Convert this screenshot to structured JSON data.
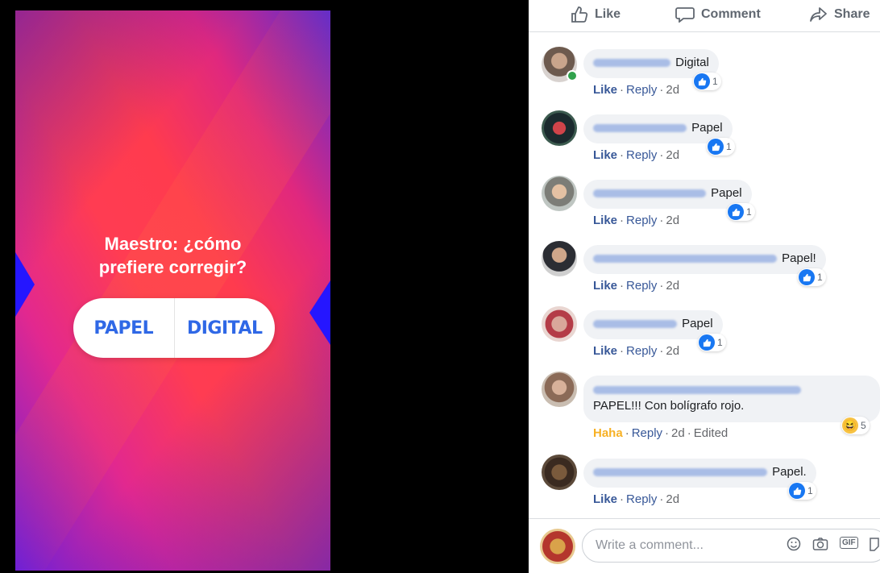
{
  "story": {
    "question_line1": "Maestro: ¿cómo",
    "question_line2": "prefiere corregir?",
    "option_a": "PAPEL",
    "option_b": "DIGITAL"
  },
  "actions": {
    "like": "Like",
    "comment": "Comment",
    "share": "Share"
  },
  "comments": [
    {
      "text": "Digital",
      "like_label": "Like",
      "reply": "Reply",
      "time": "2d",
      "reaction_count": "1"
    },
    {
      "text": "Papel",
      "like_label": "Like",
      "reply": "Reply",
      "time": "2d",
      "reaction_count": "1"
    },
    {
      "text": "Papel",
      "like_label": "Like",
      "reply": "Reply",
      "time": "2d",
      "reaction_count": "1"
    },
    {
      "text": "Papel!",
      "like_label": "Like",
      "reply": "Reply",
      "time": "2d",
      "reaction_count": "1"
    },
    {
      "text": "Papel",
      "like_label": "Like",
      "reply": "Reply",
      "time": "2d",
      "reaction_count": "1"
    },
    {
      "text": "PAPEL!!! Con bolígrafo rojo.",
      "like_label": "Haha",
      "reply": "Reply",
      "time": "2d",
      "edited": "Edited",
      "reaction_count": "5"
    },
    {
      "text": "Papel.",
      "like_label": "Like",
      "reply": "Reply",
      "time": "2d",
      "reaction_count": "1"
    }
  ],
  "compose": {
    "placeholder": "Write a comment...",
    "gif": "GIF"
  },
  "colors": {
    "facebook_blue": "#385898",
    "like_blue": "#1877f2",
    "haha_yellow": "#f7b125",
    "poll_blue": "#2f68e6"
  }
}
